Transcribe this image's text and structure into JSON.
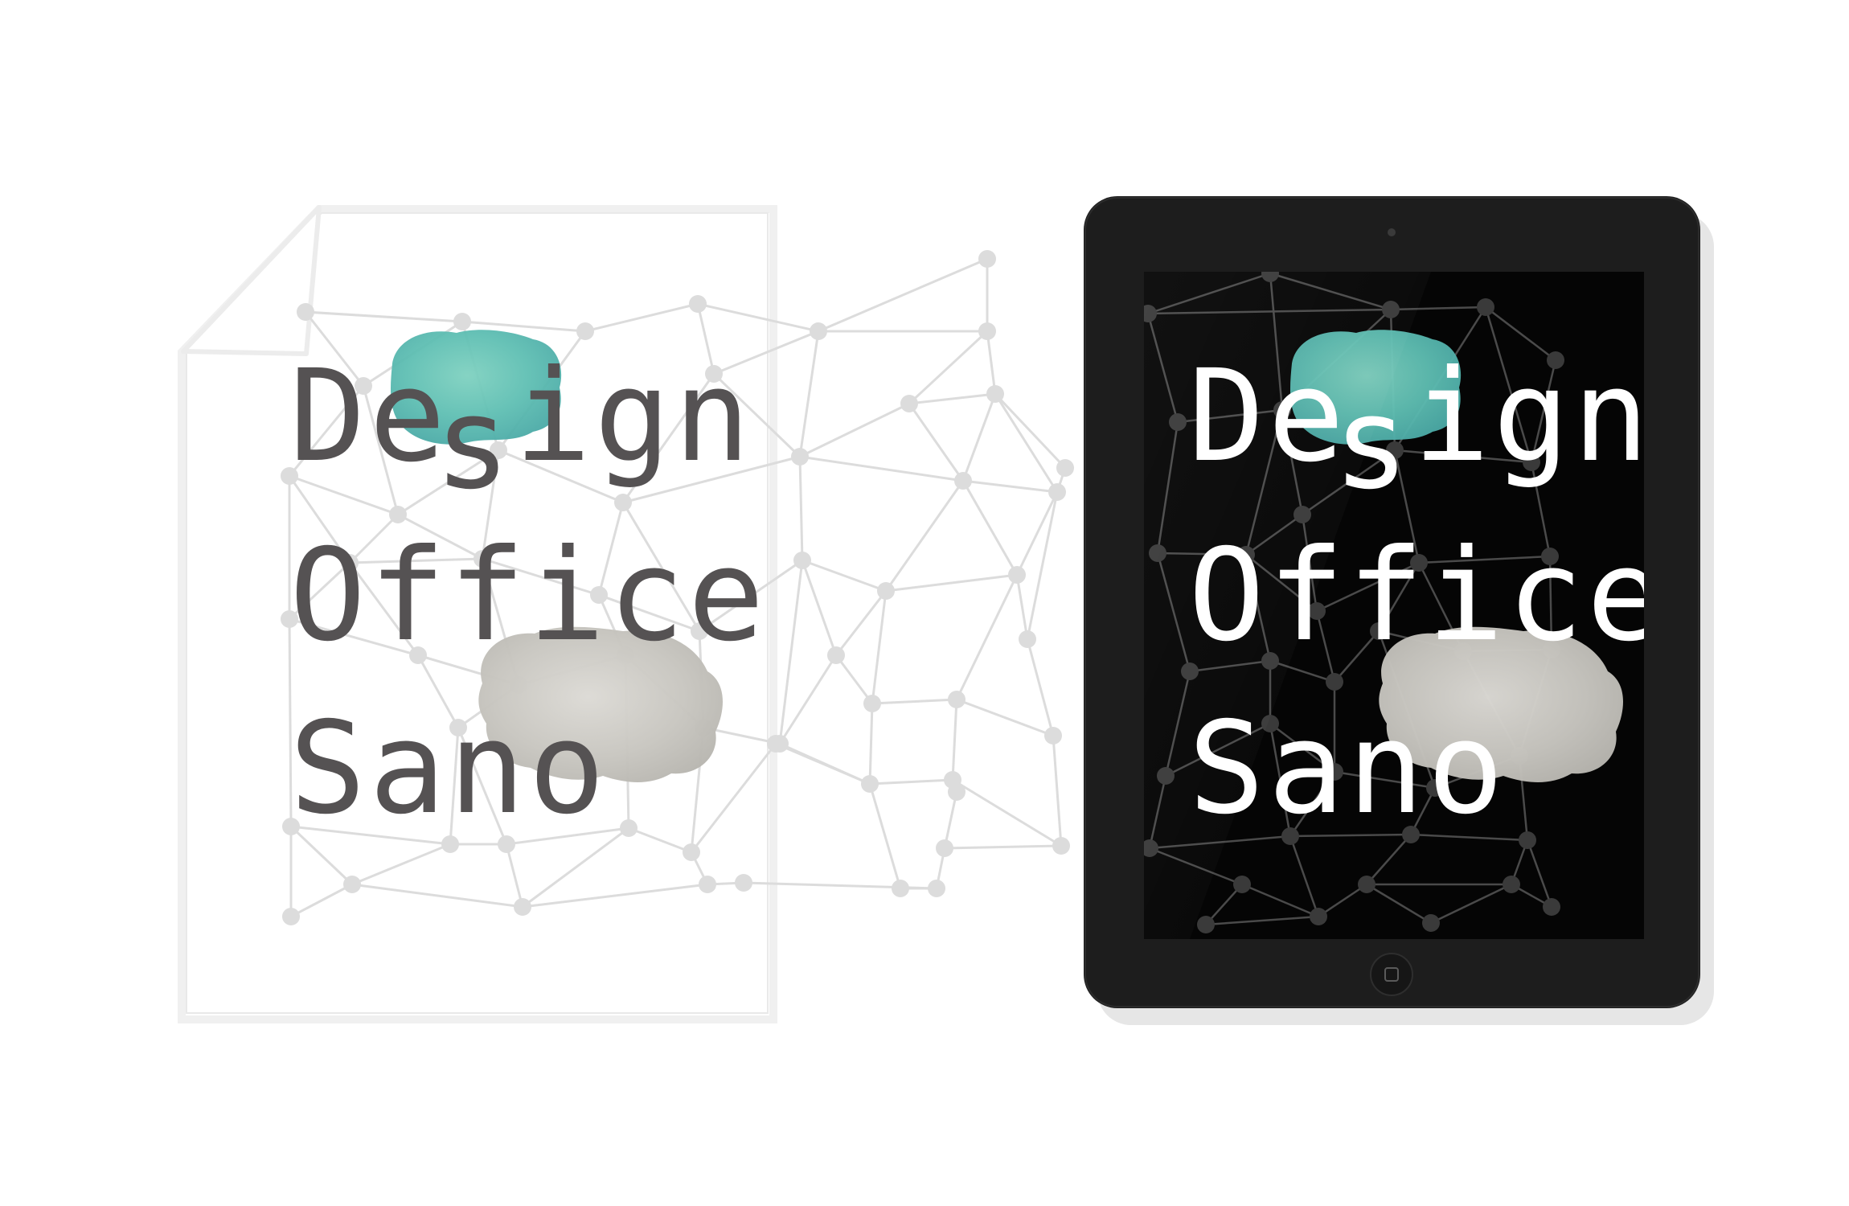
{
  "paper_logo": {
    "line1": "De",
    "descender": "s",
    "line1_rest": "ign",
    "line2": "Office",
    "line3": "Sano"
  },
  "tablet_logo": {
    "line1": "De",
    "descender": "s",
    "line1_rest": "ign",
    "line2": "Office",
    "line3": "Sano"
  },
  "colors": {
    "background": "#ffffff",
    "paper": "#ffffff",
    "paper_outline": "#eeeeee",
    "network_light": "#dcdcdc",
    "network_dark": "#4a4a4a",
    "tablet_body": "#1d1d1d",
    "tablet_screen": "#050505",
    "text_dark": "#555253",
    "text_light": "#ffffff",
    "watercolor_teal": "#5fbfb3",
    "watercolor_grey": "#c9c7c2"
  },
  "icons": [
    "paper-sheet-icon",
    "tablet-device-icon",
    "camera-icon",
    "home-button-icon"
  ]
}
